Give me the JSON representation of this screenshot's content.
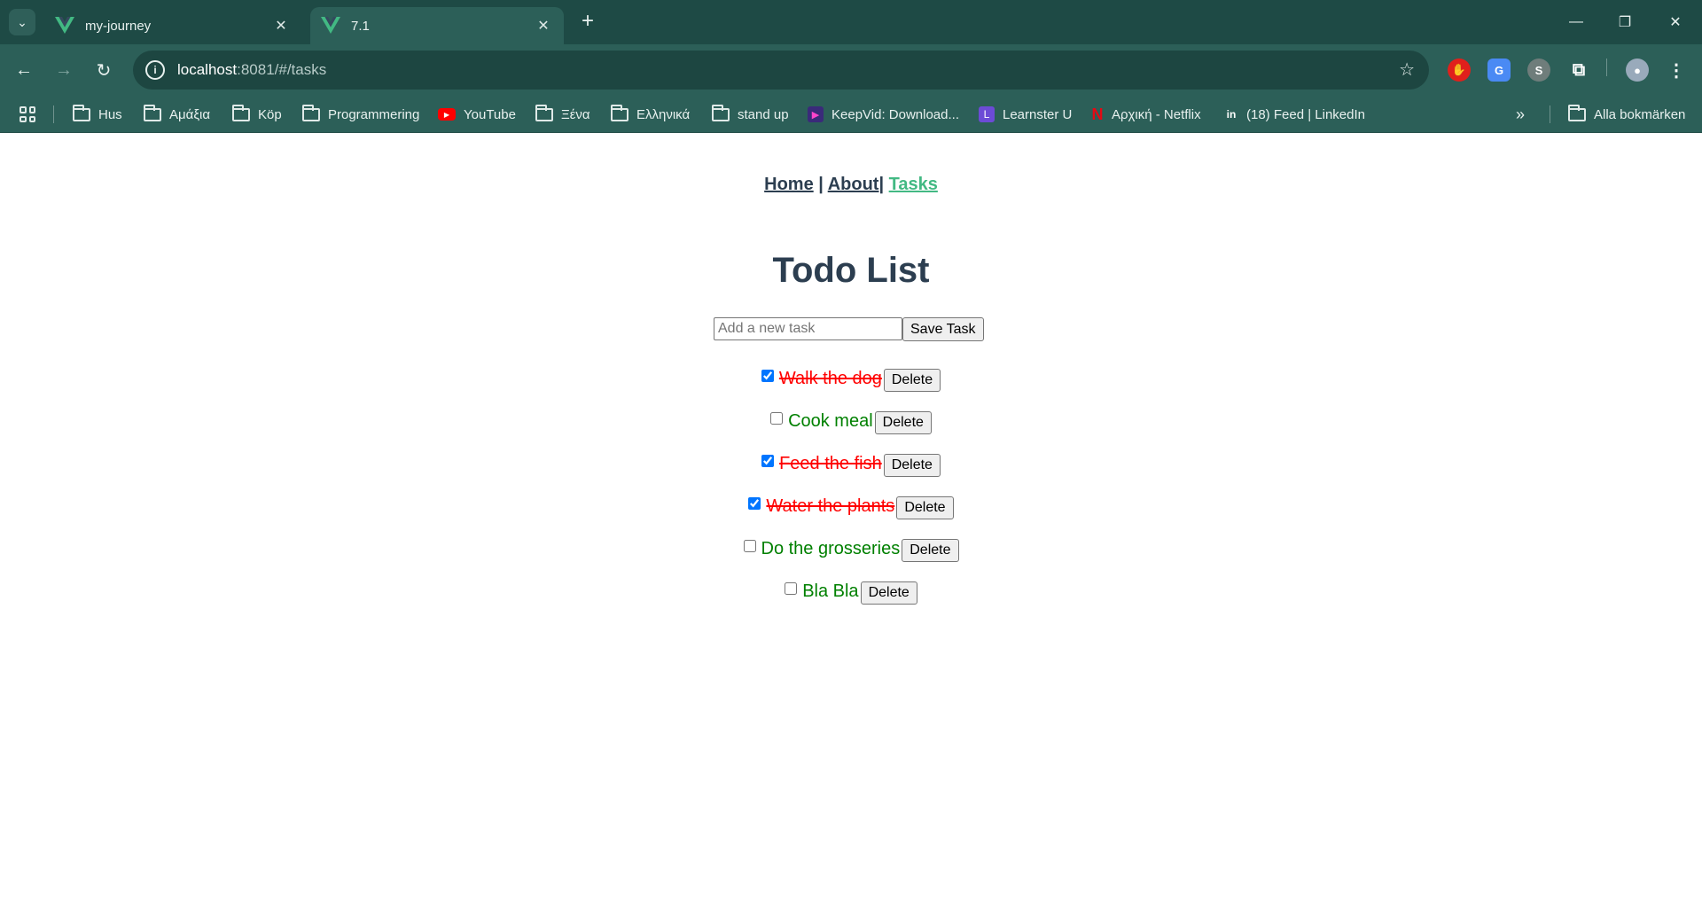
{
  "browser": {
    "tabs": [
      {
        "title": "my-journey",
        "active": false
      },
      {
        "title": "7.1",
        "active": true
      }
    ],
    "url_host": "localhost",
    "url_rest": ":8081/#/tasks",
    "bookmarks": [
      {
        "label": "Hus",
        "icon": "folder-icon"
      },
      {
        "label": "Αμάξια",
        "icon": "folder-icon"
      },
      {
        "label": "Köp",
        "icon": "folder-icon"
      },
      {
        "label": "Programmering",
        "icon": "folder-icon"
      },
      {
        "label": "YouTube",
        "icon": "youtube-icon"
      },
      {
        "label": "Ξένα",
        "icon": "folder-icon"
      },
      {
        "label": "Ελληνικά",
        "icon": "folder-icon"
      },
      {
        "label": "stand up",
        "icon": "folder-icon"
      },
      {
        "label": "KeepVid: Download...",
        "icon": "keepvid-icon"
      },
      {
        "label": "Learnster U",
        "icon": "learnster-icon"
      },
      {
        "label": "Αρχική - Netflix",
        "icon": "netflix-icon"
      },
      {
        "label": "(18) Feed | LinkedIn",
        "icon": "linkedin-icon"
      }
    ],
    "all_bookmarks": "Alla bokmärken"
  },
  "app": {
    "nav": {
      "home": "Home",
      "about": "About",
      "tasks": "Tasks",
      "separator": "|"
    },
    "title": "Todo List",
    "input_placeholder": "Add a new task",
    "save_label": "Save Task",
    "delete_label": "Delete",
    "tasks": [
      {
        "text": "Walk the dog",
        "done": true
      },
      {
        "text": "Cook meal",
        "done": false
      },
      {
        "text": "Feed the fish",
        "done": true
      },
      {
        "text": "Water the plants",
        "done": true
      },
      {
        "text": "Do the grosseries",
        "done": false
      },
      {
        "text": "Bla Bla",
        "done": false
      }
    ]
  },
  "colors": {
    "accent": "#42b983",
    "text": "#2c3e50",
    "done": "#ff0000",
    "todo": "#008000",
    "chrome_bg": "#2c5f58"
  }
}
